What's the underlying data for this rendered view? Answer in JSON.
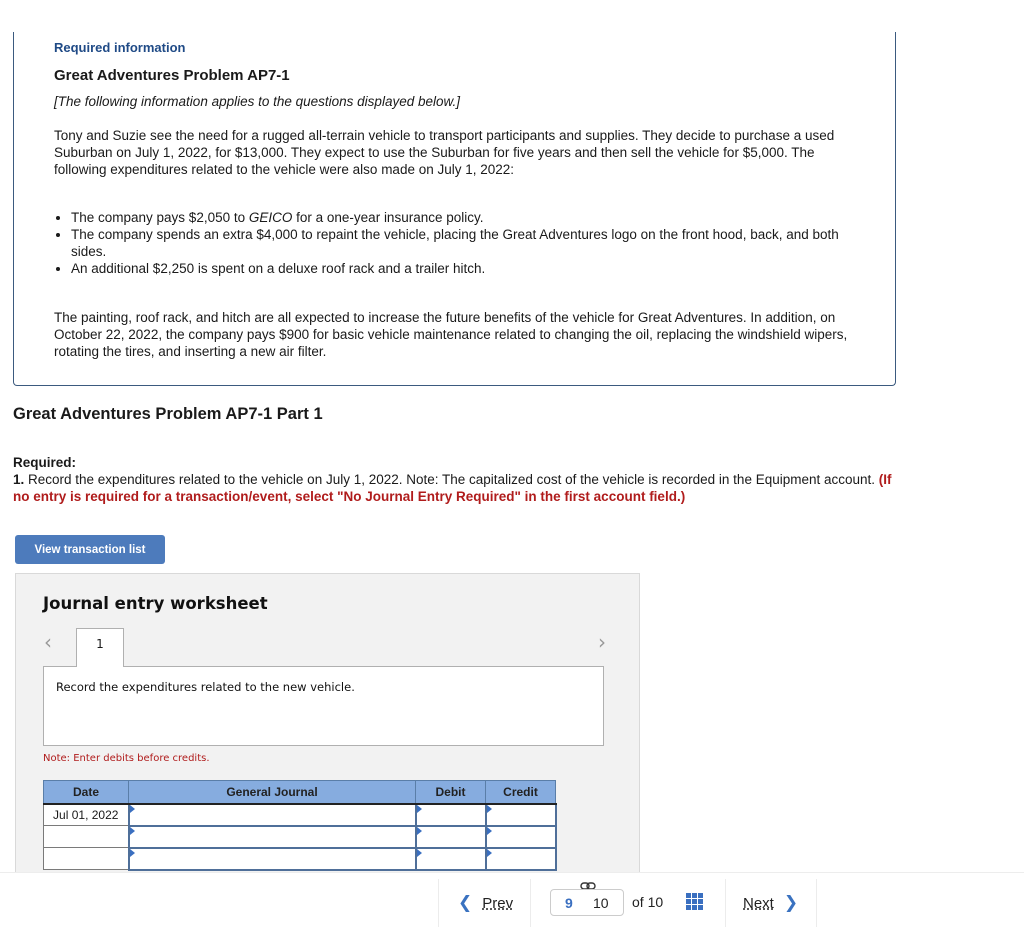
{
  "info": {
    "required_information": "Required information",
    "problem_title": "Great Adventures Problem AP7-1",
    "applies_note": "[The following information applies to the questions displayed below.]",
    "intro_paragraph": "Tony and Suzie see the need for a rugged all-terrain vehicle to transport participants and supplies. They decide to purchase a used Suburban on July 1, 2022, for $13,000. They expect to use the Suburban for five years and then sell the vehicle for $5,000. The following expenditures related to the vehicle were also made on July 1, 2022:",
    "bullets": [
      {
        "before": "The company pays $2,050 to ",
        "em": "GEICO",
        "after": " for a one-year insurance policy."
      },
      {
        "text": "The company spends an extra $4,000 to repaint the vehicle, placing the Great Adventures logo on the front hood, back, and both sides."
      },
      {
        "text": "An additional $2,250 is spent on a deluxe roof rack and a trailer hitch."
      }
    ],
    "closing_paragraph": "The painting, roof rack, and hitch are all expected to increase the future benefits of the vehicle for Great Adventures. In addition, on October 22, 2022, the company pays $900 for basic vehicle maintenance related to changing the oil, replacing the windshield wipers, rotating the tires, and inserting a new air filter."
  },
  "part": {
    "title": "Great Adventures Problem AP7-1 Part 1",
    "required_label": "Required:",
    "item_number": "1.",
    "instruction": " Record the expenditures related to the vehicle on July 1, 2022. Note: The capitalized cost of the vehicle is recorded in the Equipment account. ",
    "red_instruction": "(If no entry is required for a transaction/event, select \"No Journal Entry Required\" in the first account field.)"
  },
  "buttons": {
    "view_transaction_list": "View transaction list"
  },
  "worksheet": {
    "title": "Journal entry worksheet",
    "active_tab": "1",
    "description": "Record the expenditures related to the new vehicle.",
    "note": "Note: Enter debits before credits.",
    "columns": [
      "Date",
      "General Journal",
      "Debit",
      "Credit"
    ],
    "rows": [
      {
        "date": "Jul 01, 2022",
        "account": "",
        "debit": "",
        "credit": ""
      },
      {
        "date": "",
        "account": "",
        "debit": "",
        "credit": ""
      },
      {
        "date": "",
        "account": "",
        "debit": "",
        "credit": ""
      }
    ]
  },
  "pagination": {
    "prev_label": "Prev",
    "current_page": "9",
    "next_page": "10",
    "of_label": "of 10",
    "next_label": "Next"
  },
  "colors": {
    "accent_blue": "#4d7bbc",
    "heading_blue": "#1f4a86",
    "warning_red": "#b01c1c",
    "table_header": "#86acdf"
  }
}
